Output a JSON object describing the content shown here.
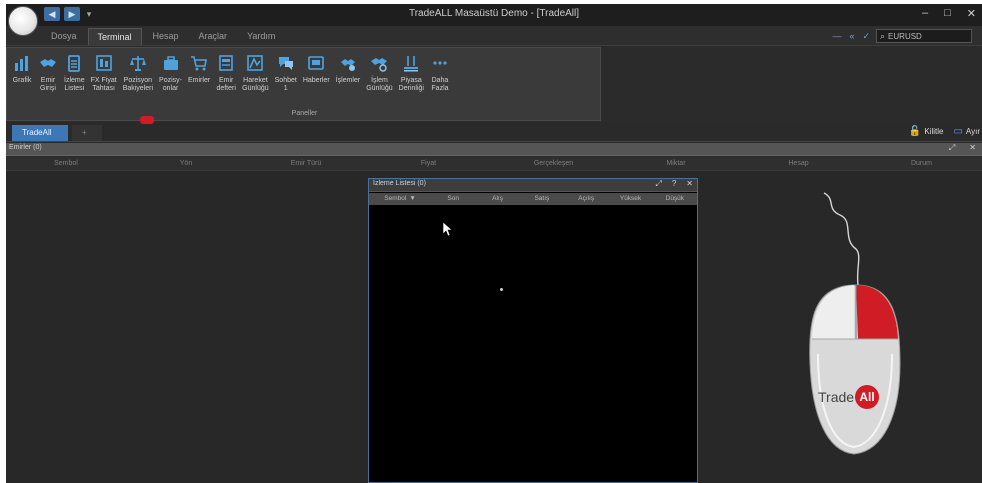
{
  "window": {
    "title": "TradeALL Masaüstü Demo - [TradeAll]",
    "controls": [
      "–",
      "□",
      "✕"
    ]
  },
  "quick_access": [
    "◀",
    "▶",
    "▾"
  ],
  "menu_tabs": [
    {
      "label": "Dosya",
      "active": false
    },
    {
      "label": "Terminal",
      "active": true
    },
    {
      "label": "Hesap",
      "active": false
    },
    {
      "label": "Araçlar",
      "active": false
    },
    {
      "label": "Yardım",
      "active": false
    }
  ],
  "search": {
    "value": "EURUSD"
  },
  "ribbon": {
    "items": [
      {
        "label": "Grafik",
        "icon": "chart-icon"
      },
      {
        "label": "Emir\nGirişi",
        "icon": "handshake-icon"
      },
      {
        "label": "İzleme\nListesi",
        "icon": "clipboard-icon"
      },
      {
        "label": "FX Fiyat\nTahtası",
        "icon": "price-board-icon"
      },
      {
        "label": "Pozisyon\nBakiyeleri",
        "icon": "scale-icon"
      },
      {
        "label": "Pozisy-\nonlar",
        "icon": "briefcase-icon"
      },
      {
        "label": "Emirler",
        "icon": "cart-icon"
      },
      {
        "label": "Emir\ndefteri",
        "icon": "order-book-icon"
      },
      {
        "label": "Hareket\nGünlüğü",
        "icon": "activity-log-icon"
      },
      {
        "label": "Sohbet\n1",
        "icon": "chat-icon"
      },
      {
        "label": "Haberler",
        "icon": "news-icon"
      },
      {
        "label": "İşlemler",
        "icon": "transactions-icon"
      },
      {
        "label": "İşlem\nGünlüğü",
        "icon": "trade-log-icon"
      },
      {
        "label": "Piyasa\nDerinliği",
        "icon": "market-depth-icon"
      },
      {
        "label": "Daha\nFazla",
        "icon": "more-icon"
      }
    ],
    "group_label": "Paneller"
  },
  "doc_tabs": [
    {
      "label": "TradeAll",
      "active": true
    },
    {
      "label": "+",
      "active": false
    }
  ],
  "right_actions": [
    {
      "label": "Kilitle",
      "icon": "lock-icon"
    },
    {
      "label": "Ayır",
      "icon": "detach-icon"
    }
  ],
  "panel": {
    "title": "Emirler (0)",
    "controls": [
      "⤢",
      "✕"
    ],
    "columns": [
      "Sembol",
      "Yön",
      "Emir Türü",
      "Fiyat",
      "Gerçekleşen",
      "Miktar",
      "Hesap",
      "Durum"
    ]
  },
  "watchlist": {
    "title": "İzleme Listesi (0)",
    "controls": [
      "⤢",
      "?",
      "✕"
    ],
    "columns": [
      "Sembol",
      "Son",
      "Alış",
      "Satış",
      "Açılış",
      "Yüksek",
      "Düşük"
    ]
  },
  "brand": {
    "name": "Trade",
    "badge": "All"
  },
  "colors": {
    "accent": "#3b78b5",
    "brand_red": "#d01c24",
    "ribbon_icon": "#4da3e0"
  }
}
